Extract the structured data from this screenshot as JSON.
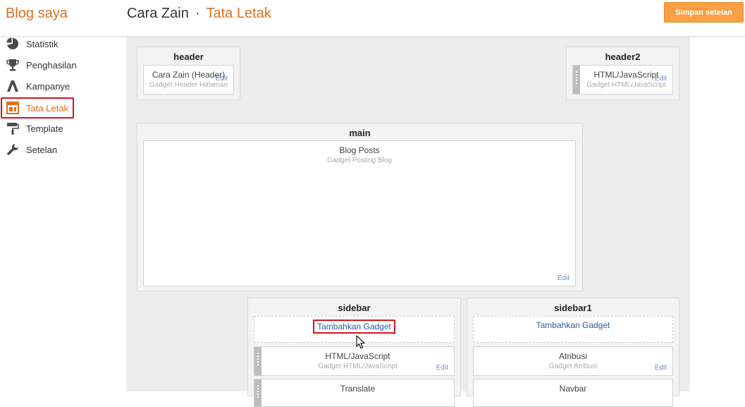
{
  "header": {
    "brand": "Blog saya",
    "blog_name": "Cara Zain",
    "separator": "·",
    "page_title": "Tata Letak",
    "save_label": "Simpan setelan"
  },
  "sidebar": {
    "items": [
      {
        "label": "Statistik",
        "icon": "pie-chart-icon"
      },
      {
        "label": "Penghasilan",
        "icon": "trophy-icon"
      },
      {
        "label": "Kampanye",
        "icon": "adwords-icon"
      },
      {
        "label": "Tata Letak",
        "icon": "layout-icon",
        "active": true
      },
      {
        "label": "Template",
        "icon": "paint-roller-icon"
      },
      {
        "label": "Setelan",
        "icon": "wrench-icon"
      }
    ]
  },
  "layout": {
    "header": {
      "title": "header",
      "widget": {
        "title": "Cara Zain (Header)",
        "subtitle": "Gadget Header Halaman",
        "edit": "Edit"
      }
    },
    "header2": {
      "title": "header2",
      "widget": {
        "title": "HTML/JavaScript",
        "subtitle": "Gadget HTML/JavaScript",
        "edit": "Edit"
      }
    },
    "main": {
      "title": "main",
      "widget": {
        "title": "Blog Posts",
        "subtitle": "Gadget Posting Blog",
        "edit": "Edit"
      }
    },
    "sidebar": {
      "title": "sidebar",
      "add_gadget": "Tambahkan Gadget",
      "widgets": [
        {
          "title": "HTML/JavaScript",
          "subtitle": "Gadget HTML/JavaScript",
          "edit": "Edit"
        },
        {
          "title": "Translate"
        }
      ]
    },
    "sidebar1": {
      "title": "sidebar1",
      "add_gadget": "Tambahkan Gadget",
      "widgets": [
        {
          "title": "Atribusi",
          "subtitle": "Gadget Atribusi",
          "edit": "Edit"
        },
        {
          "title": "Navbar"
        }
      ]
    }
  },
  "colors": {
    "accent": "#e06f1f",
    "save_button": "#f8a043",
    "link": "#2c5aa0",
    "highlight": "#d4141c"
  }
}
